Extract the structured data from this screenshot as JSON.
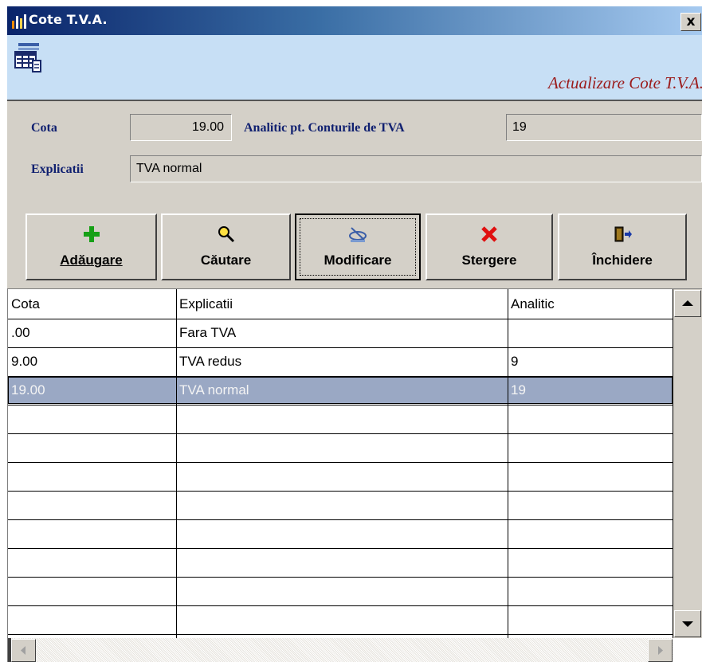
{
  "window": {
    "title": "Cote T.V.A.",
    "close_symbol": "x",
    "banner_title": "Actualizare Cote T.V.A."
  },
  "form": {
    "cota_label": "Cota",
    "cota_value": "19.00",
    "analitic_label": "Analitic pt. Conturile de TVA",
    "analitic_value": "19",
    "explicatii_label": "Explicatii",
    "explicatii_value": "TVA normal"
  },
  "toolbar": {
    "add_label": "Adăugare",
    "search_label": "Căutare",
    "modify_label": "Modificare",
    "delete_label": "Stergere",
    "close_label": "Închidere",
    "add_icon": "plus-icon",
    "search_icon": "magnifier-icon",
    "modify_icon": "edit-icon",
    "delete_icon": "delete-icon",
    "close_icon": "exit-door-icon"
  },
  "grid": {
    "columns": [
      "Cota",
      "Explicatii",
      "Analitic"
    ],
    "rows": [
      [
        ".00",
        "Fara TVA",
        ""
      ],
      [
        "9.00",
        "TVA redus",
        "9"
      ],
      [
        "19.00",
        "TVA normal",
        "19"
      ]
    ],
    "selected_row": 2
  },
  "colors": {
    "title_gradient_start": "#0a246a",
    "title_gradient_end": "#a6caf0",
    "banner_bg": "#c7dff5",
    "banner_title_color": "#9b1b1b",
    "label_color": "#102070",
    "selected_row_bg": "#9aa8c4",
    "window_bg": "#d4d0c8"
  }
}
